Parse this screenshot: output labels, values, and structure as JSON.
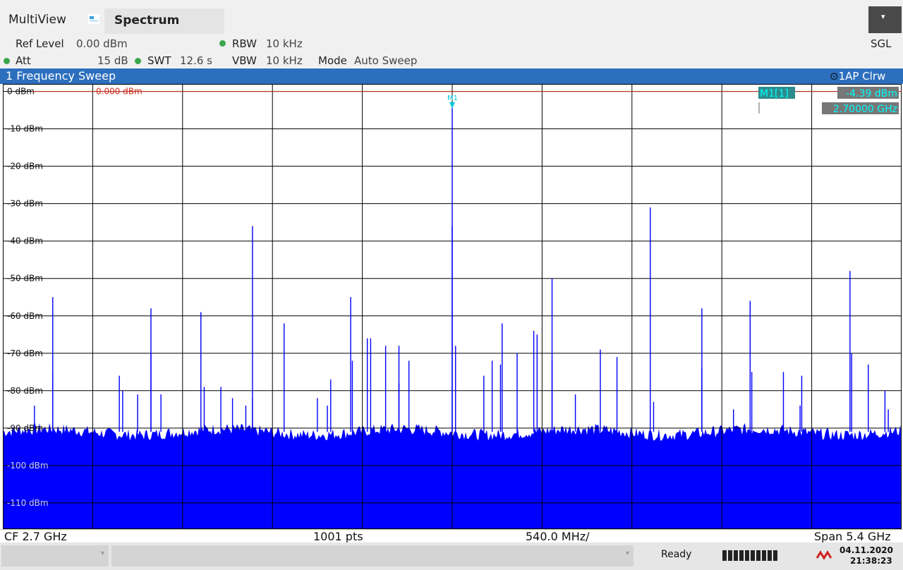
{
  "app": {
    "title": "MultiView",
    "tab": "Spectrum",
    "menu_glyph": "▾"
  },
  "info": {
    "ref_level_label": "Ref Level",
    "ref_level_value": "0.00 dBm",
    "att_label": "Att",
    "att_value": "15 dB",
    "swt_label": "SWT",
    "swt_value": "12.6 s",
    "rbw_label": "RBW",
    "rbw_value": "10 kHz",
    "vbw_label": "VBW",
    "vbw_value": "10 kHz",
    "mode_label": "Mode",
    "mode_value": "Auto Sweep",
    "sgl": "SGL"
  },
  "panel": {
    "title": "1 Frequency Sweep",
    "trace": "1AP Clrw",
    "trace_symbol": "⊙"
  },
  "marker": {
    "name": "M1[1]",
    "level": "-4.39 dBm",
    "freq": "2.70000 GHz",
    "plot_label": "M1",
    "freq_ghz": 2.7,
    "level_dbm": -4.39
  },
  "ref_line_label": "0.000 dBm",
  "bottom": {
    "cf": "CF 2.7 GHz",
    "pts": "1001 pts",
    "div": "540.0 MHz/",
    "span": "Span 5.4 GHz"
  },
  "status": {
    "ready": "Ready",
    "date": "04.11.2020",
    "time": "21:38:23",
    "scroll_glyph": "▾"
  },
  "colors": {
    "trace": "#0000ff",
    "ref_line": "#d03020",
    "marker": "#00c8e0",
    "header": "#2c6fbe",
    "marker_box": "#2e8b8b"
  },
  "chart_data": {
    "type": "line",
    "xlabel": "",
    "ylabel": "",
    "xlim": [
      0,
      5.4
    ],
    "ylim": [
      -117,
      2
    ],
    "y_ticks": [
      "0 dBm",
      "-10 dBm",
      "-20 dBm",
      "-30 dBm",
      "-40 dBm",
      "-50 dBm",
      "-60 dBm",
      "-70 dBm",
      "-80 dBm",
      "-90 dBm",
      "-100 dBm",
      "-110 dBm"
    ],
    "y_tick_values": [
      0,
      -10,
      -20,
      -30,
      -40,
      -50,
      -60,
      -70,
      -80,
      -90,
      -100,
      -110
    ],
    "grid": true,
    "noise_floor_dbm": -91,
    "series": [
      {
        "values": [
          [
            0.3,
            -55
          ],
          [
            0.3,
            -75
          ],
          [
            0.19,
            -84
          ],
          [
            0.7,
            -76
          ],
          [
            0.72,
            -80
          ],
          [
            0.81,
            -81
          ],
          [
            0.89,
            -58
          ],
          [
            0.89,
            -70
          ],
          [
            0.95,
            -81
          ],
          [
            1.19,
            -59
          ],
          [
            1.21,
            -79
          ],
          [
            1.31,
            -79
          ],
          [
            1.38,
            -82
          ],
          [
            1.46,
            -84
          ],
          [
            1.5,
            -36
          ],
          [
            1.5,
            -82
          ],
          [
            1.69,
            -62
          ],
          [
            1.89,
            -82
          ],
          [
            1.95,
            -84
          ],
          [
            1.97,
            -77
          ],
          [
            2.09,
            -55
          ],
          [
            2.1,
            -72
          ],
          [
            2.19,
            -66
          ],
          [
            2.21,
            -66
          ],
          [
            2.3,
            -68
          ],
          [
            2.38,
            -68
          ],
          [
            2.38,
            -78
          ],
          [
            2.44,
            -72
          ],
          [
            2.7,
            -4.39
          ],
          [
            2.7,
            -36
          ],
          [
            2.72,
            -68
          ],
          [
            2.89,
            -76
          ],
          [
            2.94,
            -72
          ],
          [
            2.99,
            -73
          ],
          [
            3.0,
            -62
          ],
          [
            3.09,
            -70
          ],
          [
            3.19,
            -64
          ],
          [
            3.21,
            -65
          ],
          [
            3.3,
            -50
          ],
          [
            3.3,
            -72
          ],
          [
            3.44,
            -81
          ],
          [
            3.59,
            -69
          ],
          [
            3.69,
            -71
          ],
          [
            3.89,
            -31
          ],
          [
            3.91,
            -83
          ],
          [
            4.2,
            -58
          ],
          [
            4.2,
            -74
          ],
          [
            4.39,
            -85
          ],
          [
            4.49,
            -56
          ],
          [
            4.5,
            -75
          ],
          [
            4.69,
            -75
          ],
          [
            4.79,
            -84
          ],
          [
            4.8,
            -76
          ],
          [
            5.09,
            -48
          ],
          [
            5.1,
            -70
          ],
          [
            5.2,
            -73
          ],
          [
            5.3,
            -80
          ],
          [
            5.32,
            -85
          ]
        ]
      }
    ]
  }
}
